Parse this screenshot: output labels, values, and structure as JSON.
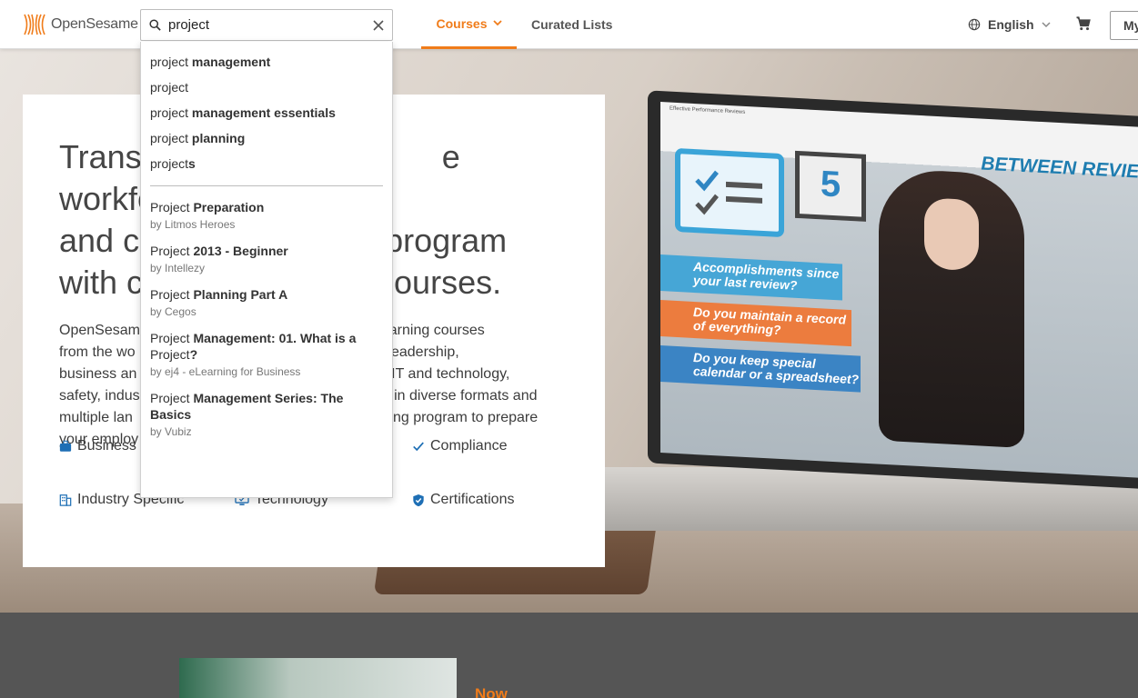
{
  "header": {
    "logo_text": "OpenSesame",
    "search_value": "project",
    "nav_courses": "Courses",
    "nav_curated": "Curated Lists",
    "language": "English",
    "my_button": "My"
  },
  "colors": {
    "accent": "#f07c1a",
    "dark_strip": "#555555",
    "check_blue": "#1e6fb5"
  },
  "suggestions": [
    {
      "prefix": "project",
      "suffix": " management"
    },
    {
      "prefix": "project",
      "suffix": ""
    },
    {
      "prefix": "project",
      "suffix": " management essentials"
    },
    {
      "prefix": "project",
      "suffix": " planning"
    },
    {
      "prefix": "project",
      "suffix": "s"
    }
  ],
  "courses": [
    {
      "prefix": "Project",
      "suffix": " Preparation",
      "by": "by Litmos Heroes"
    },
    {
      "prefix": "Project",
      "suffix": " 2013 - Beginner",
      "by": "by Intellezy"
    },
    {
      "prefix": "Project",
      "suffix": " Planning Part A",
      "by": "by Cegos"
    },
    {
      "prefix": "Project",
      "suffix": " Management: 01. What is a",
      "prefix2": "Project",
      "suffix2": "?",
      "by": "by ej4 - eLearning for Business"
    },
    {
      "prefix": "Project",
      "suffix": " Management Series: The Basics",
      "by": "by Vubiz"
    }
  ],
  "hero": {
    "title_line1": "Trans",
    "title_line1_end": "e workforce",
    "title_line2": "and co",
    "title_line2_end": "program",
    "title_line3": "with c",
    "title_line3_end": "courses.",
    "body_l1a": "OpenSesam",
    "body_l1b": "alog of elearning courses",
    "body_l2a": "from the wo",
    "body_l2b": "ent and leadership,",
    "body_l3a": "business an",
    "body_l3b": "e, IT and technology,",
    "body_l4a": "safety, indus",
    "body_l4b": "s in diverse formats and",
    "body_l5a": "multiple lan",
    "body_l5b": "ining program to prepare",
    "body_l6a": "your employ"
  },
  "categories": {
    "business": "Business",
    "compliance": "Compliance",
    "industry": "Industry Specific",
    "technology": "Technology",
    "certifications": "Certifications"
  },
  "screen": {
    "header": "Effective Performance Reviews",
    "banner": "BETWEEN REVIEW",
    "cal_num": "5",
    "q1": "Accomplishments since your last review?",
    "q2": "Do you maintain a record of everything?",
    "q3": "Do you keep special calendar or a spreadsheet?"
  },
  "bottom": {
    "label": "Now"
  }
}
